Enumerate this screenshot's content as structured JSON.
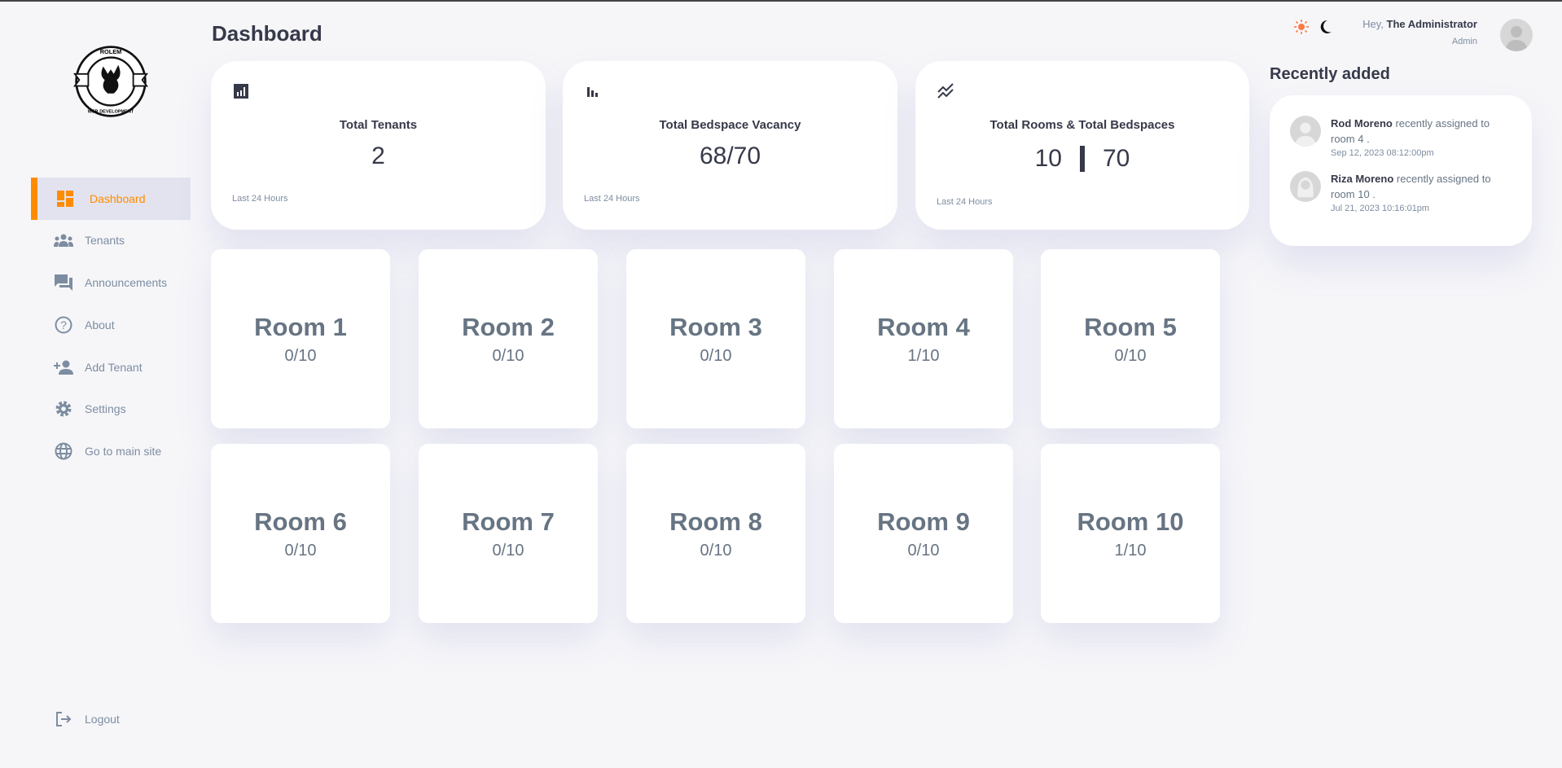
{
  "app": {
    "logo_text": "ROLEM 2023 WEB DEVELOPMENT",
    "brand_color": "#ff8c00"
  },
  "sidebar": {
    "items": [
      {
        "label": "Dashboard",
        "icon": "dashboard-icon",
        "active": true
      },
      {
        "label": "Tenants",
        "icon": "groups-icon"
      },
      {
        "label": "Announcements",
        "icon": "forum-icon"
      },
      {
        "label": "About",
        "icon": "help-circle-icon"
      },
      {
        "label": "Add Tenant",
        "icon": "person-add-icon"
      },
      {
        "label": "Settings",
        "icon": "gear-icon"
      },
      {
        "label": "Go to main site",
        "icon": "globe-icon"
      }
    ],
    "logout": "Logout"
  },
  "header": {
    "title": "Dashboard",
    "greeting": "Hey,",
    "user_name": "The Administrator",
    "role": "Admin",
    "theme_light": "sun-icon",
    "theme_dark": "moon-icon"
  },
  "stats": [
    {
      "label": "Total Tenants",
      "value": "2",
      "footer": "Last 24 Hours",
      "icon": "analytics-icon"
    },
    {
      "label": "Total Bedspace Vacancy",
      "value": "68/70",
      "footer": "Last 24 Hours",
      "icon": "bar-chart-icon"
    },
    {
      "label": "Total Rooms & Total Bedspaces",
      "value_a": "10",
      "value_b": "70",
      "footer": "Last 24 Hours",
      "icon": "stacked-line-chart-icon"
    }
  ],
  "rooms": [
    {
      "name": "Room 1",
      "occupancy": "0/10"
    },
    {
      "name": "Room 2",
      "occupancy": "0/10"
    },
    {
      "name": "Room 3",
      "occupancy": "0/10"
    },
    {
      "name": "Room 4",
      "occupancy": "1/10"
    },
    {
      "name": "Room 5",
      "occupancy": "0/10"
    },
    {
      "name": "Room 6",
      "occupancy": "0/10"
    },
    {
      "name": "Room 7",
      "occupancy": "0/10"
    },
    {
      "name": "Room 8",
      "occupancy": "0/10"
    },
    {
      "name": "Room 9",
      "occupancy": "0/10"
    },
    {
      "name": "Room 10",
      "occupancy": "1/10"
    }
  ],
  "recent": {
    "title": "Recently added",
    "items": [
      {
        "name": "Rod Moreno",
        "action": "recently assigned to room 4 .",
        "time": "Sep 12, 2023 08:12:00pm"
      },
      {
        "name": "Riza Moreno",
        "action": "recently assigned to room 10 .",
        "time": "Jul 21, 2023 10:16:01pm"
      }
    ]
  }
}
